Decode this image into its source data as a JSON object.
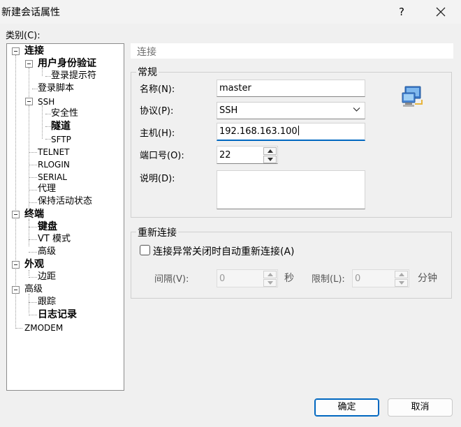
{
  "window": {
    "title": "新建会话属性",
    "help_label": "?"
  },
  "category_label": "类别(C):",
  "tree": {
    "items": [
      {
        "label": "连接"
      },
      {
        "label": "用户身份验证"
      },
      {
        "label": "登录提示符"
      },
      {
        "label": "登录脚本"
      },
      {
        "label": "SSH"
      },
      {
        "label": "安全性"
      },
      {
        "label": "隧道"
      },
      {
        "label": "SFTP"
      },
      {
        "label": "TELNET"
      },
      {
        "label": "RLOGIN"
      },
      {
        "label": "SERIAL"
      },
      {
        "label": "代理"
      },
      {
        "label": "保持活动状态"
      },
      {
        "label": "终端"
      },
      {
        "label": "键盘"
      },
      {
        "label": "VT 模式"
      },
      {
        "label": "高级"
      },
      {
        "label": "外观"
      },
      {
        "label": "边距"
      },
      {
        "label": "高级"
      },
      {
        "label": "跟踪"
      },
      {
        "label": "日志记录"
      },
      {
        "label": "ZMODEM"
      }
    ]
  },
  "panel": {
    "header": "连接",
    "general": {
      "title": "常规",
      "name_label": "名称(N):",
      "name_value": "master",
      "protocol_label": "协议(P):",
      "protocol_value": "SSH",
      "host_label": "主机(H):",
      "host_value": "192.168.163.100",
      "port_label": "端口号(O):",
      "port_value": "22",
      "desc_label": "说明(D):",
      "desc_value": ""
    },
    "reconnect": {
      "title": "重新连接",
      "auto_label": "连接异常关闭时自动重新连接(A)",
      "interval_label": "间隔(V):",
      "interval_value": "0",
      "interval_unit": "秒",
      "limit_label": "限制(L):",
      "limit_value": "0",
      "limit_unit": "分钟"
    }
  },
  "buttons": {
    "ok": "确定",
    "cancel": "取消"
  },
  "colors": {
    "accent": "#0067c0",
    "window_bg": "#f0f0f0"
  }
}
